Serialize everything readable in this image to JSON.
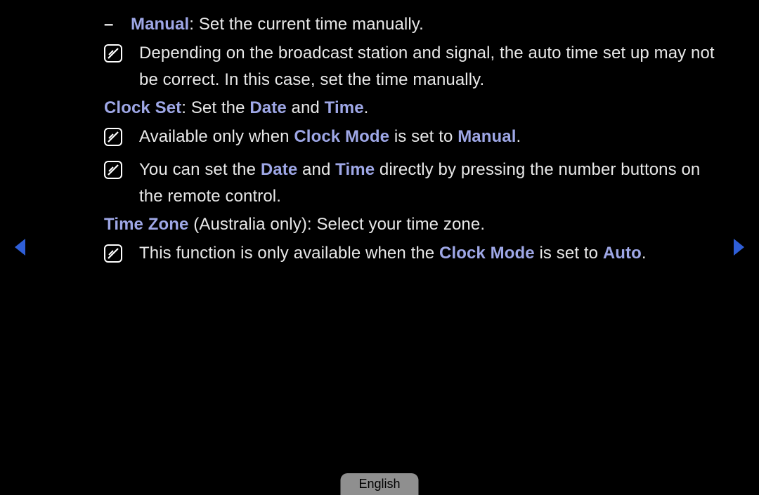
{
  "lines": {
    "manual_label": "Manual",
    "manual_desc": ": Set the current time manually.",
    "note1": "Depending on the broadcast station and signal, the auto time set up may not be correct. In this case, set the time manually.",
    "clockset_label": "Clock Set",
    "clockset_mid": ": Set the ",
    "clockset_date": "Date",
    "clockset_and": " and ",
    "clockset_time": "Time",
    "clockset_end": ".",
    "note2_a": "Available only when ",
    "note2_b": "Clock Mode",
    "note2_c": " is set to ",
    "note2_d": "Manual",
    "note2_e": ".",
    "note3_a": "You can set the ",
    "note3_b": "Date",
    "note3_c": " and ",
    "note3_d": "Time",
    "note3_e": " directly by pressing the number buttons on the remote control.",
    "timezone_label": "Time Zone",
    "timezone_rest": " (Australia only): Select your time zone.",
    "note4_a": "This function is only available when the ",
    "note4_b": "Clock Mode",
    "note4_c": " is set to ",
    "note4_d": "Auto",
    "note4_e": "."
  },
  "footer": {
    "language": "English"
  },
  "dash": "–"
}
